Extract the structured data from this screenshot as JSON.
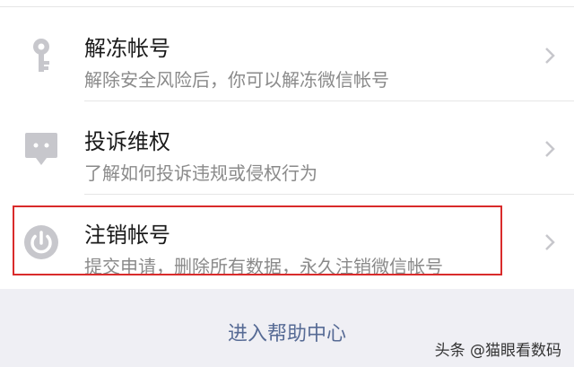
{
  "items": [
    {
      "title": "解冻帐号",
      "desc": "解除安全风险后，你可以解冻微信帐号",
      "icon": "key-icon"
    },
    {
      "title": "投诉维权",
      "desc": "了解如何投诉违规或侵权行为",
      "icon": "chat-bubble-icon"
    },
    {
      "title": "注销帐号",
      "desc": "提交申请，删除所有数据，永久注销微信帐号",
      "icon": "power-icon"
    }
  ],
  "footer": {
    "help_link": "进入帮助中心",
    "watermark": "头条 @猫眼看数码"
  },
  "colors": {
    "highlight_border": "#d92b2b",
    "link": "#576b95",
    "icon": "#c7c7cc"
  }
}
